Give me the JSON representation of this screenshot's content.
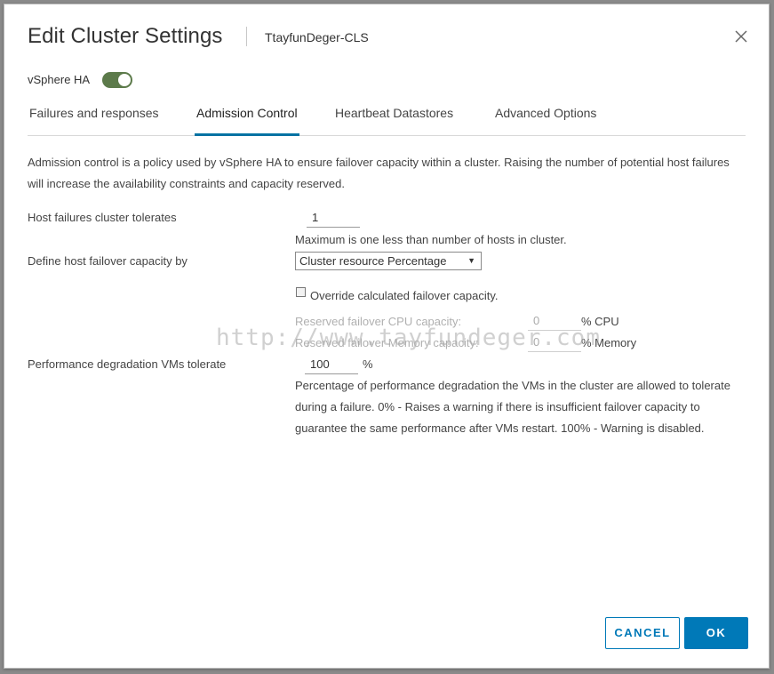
{
  "dialog": {
    "title": "Edit Cluster Settings",
    "cluster_name": "TtayfunDeger-CLS"
  },
  "vsphere_ha": {
    "label": "vSphere HA",
    "enabled": true
  },
  "tabs": [
    {
      "label": "Failures and responses",
      "active": false
    },
    {
      "label": "Admission Control",
      "active": true
    },
    {
      "label": "Heartbeat Datastores",
      "active": false
    },
    {
      "label": "Advanced Options",
      "active": false
    }
  ],
  "admission": {
    "description": "Admission control is a policy used by vSphere HA to ensure failover capacity within a cluster. Raising the number of potential host failures will increase the availability constraints and capacity reserved.",
    "host_failures_label": "Host failures cluster tolerates",
    "host_failures_value": "1",
    "host_failures_hint": "Maximum is one less than number of hosts in cluster.",
    "capacity_label": "Define host failover capacity by",
    "capacity_selected": "Cluster resource Percentage",
    "override_label": "Override calculated failover capacity.",
    "override_checked": false,
    "cpu_label": "Reserved failover CPU capacity:",
    "cpu_value": "0",
    "cpu_unit": "% CPU",
    "memory_label": "Reserved failover Memory capacity:",
    "memory_value": "0",
    "memory_unit": "% Memory",
    "perf_label": "Performance degradation VMs tolerate",
    "perf_value": "100",
    "perf_unit": "%",
    "perf_description": "Percentage of performance degradation the VMs in the cluster are allowed to tolerate during a failure. 0% - Raises a warning if there is insufficient failover capacity to guarantee the same performance after VMs restart. 100% - Warning is disabled."
  },
  "watermark": "http://www.tayfundeger.com",
  "buttons": {
    "cancel": "CANCEL",
    "ok": "OK"
  },
  "colors": {
    "accent": "#0079b8",
    "toggle_on": "#5c7a4a"
  }
}
